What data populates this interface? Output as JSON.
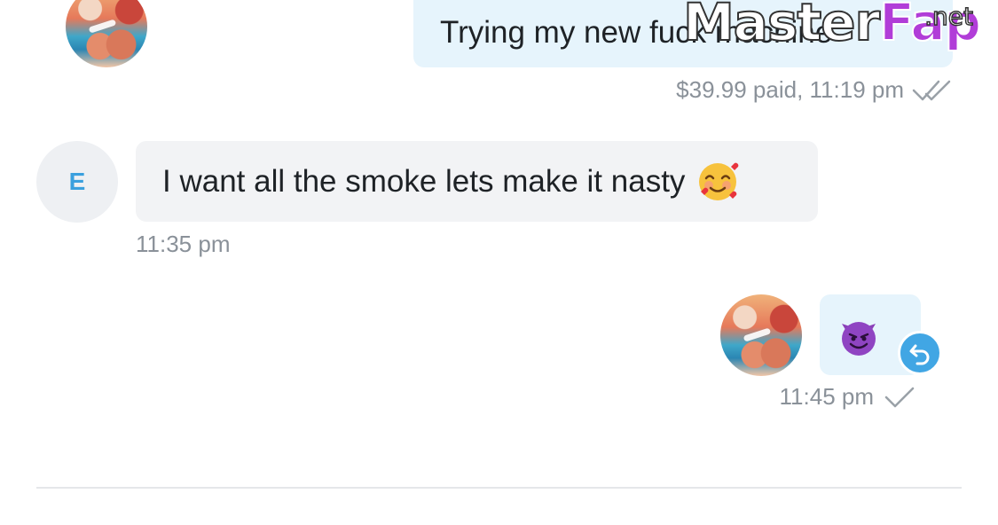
{
  "messages": [
    {
      "direction": "outgoing",
      "text": "Trying my new fuck machine",
      "meta_text": "$39.99 paid, 11:19 pm",
      "status_icon": "double-check-icon"
    },
    {
      "direction": "incoming",
      "sender_initial": "E",
      "text": "I want all the smoke lets make it nasty",
      "emoji_icon": "smiling-face-with-hearts-icon",
      "time": "11:35 pm"
    },
    {
      "direction": "outgoing",
      "emoji_icon": "smiling-devil-icon",
      "time": "11:45 pm",
      "status_icon": "single-check-icon",
      "badge_icon": "reply-arrow-icon"
    }
  ],
  "watermark": {
    "part1": "Master",
    "part2": "Fap",
    "suffix": ".net"
  },
  "colors": {
    "outgoing_bubble": "#e6f4fc",
    "incoming_bubble": "#f2f3f5",
    "accent": "#41a6e4",
    "meta_text": "#8a9199",
    "watermark_accent": "#b13dd8"
  }
}
